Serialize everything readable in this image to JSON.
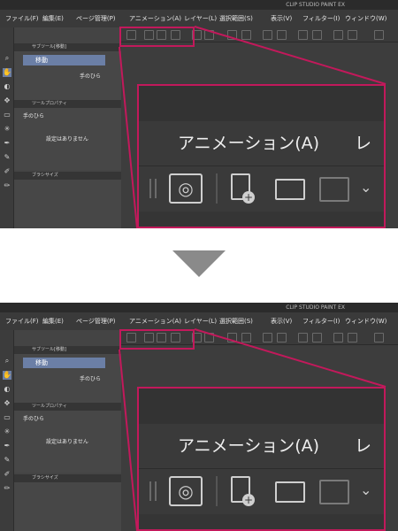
{
  "app": {
    "title": "CLIP STUDIO PAINT EX"
  },
  "menu": [
    "ファイル(F)",
    "編集(E)",
    "ページ管理(P)",
    "アニメーション(A)",
    "レイヤー(L)",
    "選択範囲(S)",
    "表示(V)",
    "フィルター(I)",
    "ウィンドウ(W)"
  ],
  "panels": {
    "sub_tool_header": "サブツール[移動]",
    "move_tool": "移動",
    "hand_tool": "手のひら",
    "tool_property_header": "ツールプロパティ",
    "tool_property_name": "手のひら",
    "no_settings": "設定はありません",
    "brush_size_header": "ブラシサイズ"
  },
  "zoom": {
    "menu_animation": "アニメーション(A)",
    "menu_layer_partial": "レイ"
  },
  "colors": {
    "highlight": "#c2195b",
    "arrow": "#8a8a8a"
  },
  "icons": [
    "clip-studio-icon",
    "new-file-icon",
    "open-folder-icon",
    "save-tray-icon",
    "chevron-down-icon"
  ]
}
